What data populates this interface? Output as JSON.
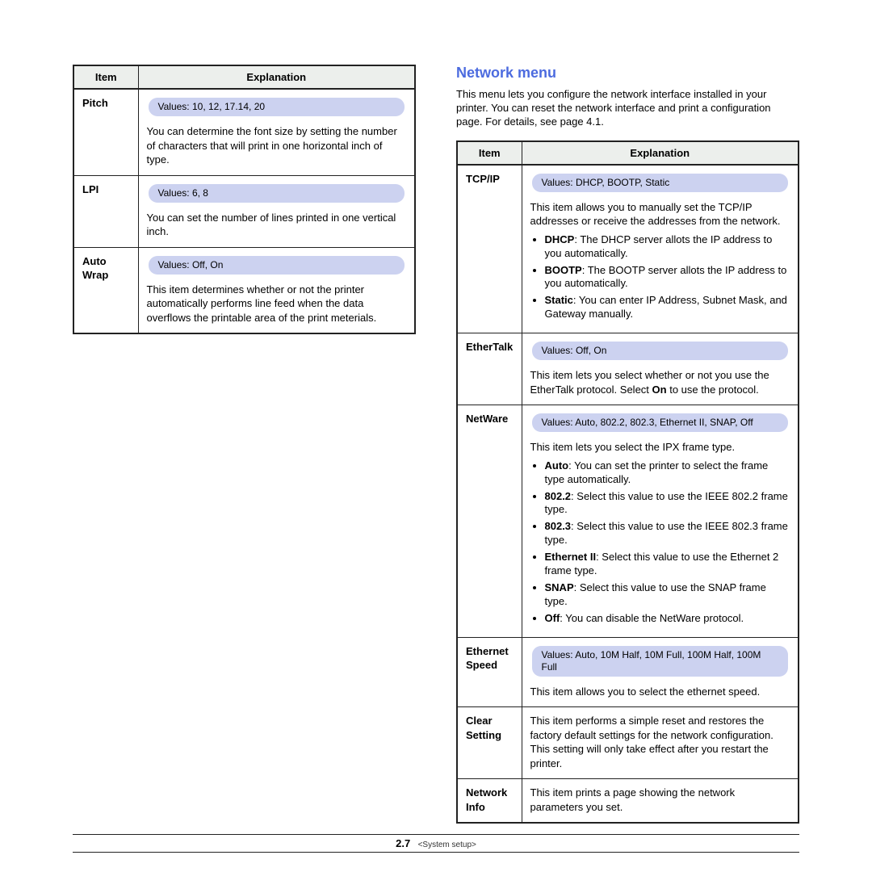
{
  "left_table": {
    "headers": [
      "Item",
      "Explanation"
    ],
    "rows": [
      {
        "item": "Pitch",
        "values": "Values: 10, 12, 17.14, 20",
        "desc": "You can determine the font size by setting the number of characters that will print in one horizontal inch of type."
      },
      {
        "item": "LPI",
        "values": "Values: 6, 8",
        "desc": "You can set the number of lines printed in one vertical inch."
      },
      {
        "item": "Auto Wrap",
        "values": "Values: Off, On",
        "desc": "This item determines whether or not the printer automatically performs line feed when the data overflows the printable area of the print meterials."
      }
    ]
  },
  "right": {
    "title": "Network menu",
    "intro": "This menu lets you configure the network interface installed in your printer. You can reset the network interface and print a configuration page. For details, see page 4.1.",
    "headers": [
      "Item",
      "Explanation"
    ],
    "rows": {
      "tcpip": {
        "item": "TCP/IP",
        "values": "Values: DHCP, BOOTP, Static",
        "desc": "This item allows you to manually set the TCP/IP addresses or receive the addresses from the network.",
        "bullets": [
          {
            "b": "DHCP",
            "t": ": The DHCP server allots the IP address to you automatically."
          },
          {
            "b": "BOOTP",
            "t": ": The BOOTP server allots the IP address to you automatically."
          },
          {
            "b": "Static",
            "t": ": You can enter IP Address, Subnet Mask, and Gateway manually."
          }
        ]
      },
      "ethertalk": {
        "item": "EtherTalk",
        "values": "Values: Off, On",
        "desc_pre": "This item lets you select whether or not you use the EtherTalk protocol. Select ",
        "desc_bold": "On",
        "desc_post": " to use the protocol."
      },
      "netware": {
        "item": "NetWare",
        "values": "Values: Auto, 802.2, 802.3, Ethernet II, SNAP, Off",
        "desc": "This item lets you select the IPX frame type.",
        "bullets": [
          {
            "b": "Auto",
            "t": ": You can set the printer to select the frame type automatically."
          },
          {
            "b": "802.2",
            "t": ": Select this value to use the IEEE 802.2 frame type."
          },
          {
            "b": "802.3",
            "t": ": Select this value to use the IEEE 802.3 frame type."
          },
          {
            "b": "Ethernet II",
            "t": ": Select this value to use the Ethernet 2 frame type."
          },
          {
            "b": "SNAP",
            "t": ": Select this value to use the SNAP frame type."
          },
          {
            "b": "Off",
            "t": ": You can disable the NetWare protocol."
          }
        ]
      },
      "ethspeed": {
        "item": "Ethernet Speed",
        "values": "Values: Auto, 10M Half, 10M Full, 100M Half, 100M Full",
        "desc": "This item allows you to select the ethernet speed."
      },
      "clear": {
        "item": "Clear Setting",
        "desc": "This item performs a simple reset and restores the factory default settings for the network configuration. This setting will only take effect after you restart the printer."
      },
      "ninfo": {
        "item": "Network Info",
        "desc": "This item prints a page showing the network parameters you set."
      }
    }
  },
  "footer": {
    "num": "2.7",
    "label": "<System setup>"
  }
}
